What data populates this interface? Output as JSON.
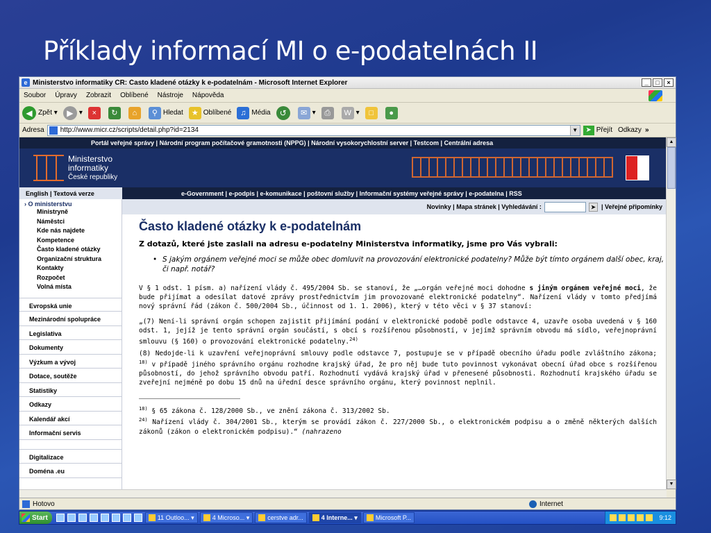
{
  "slide": {
    "title": "Příklady informací MI o e-podatelnách II"
  },
  "window": {
    "title": "Ministerstvo informatiky ČR: Často kladené otázky k e-podatelnám - Microsoft Internet Explorer"
  },
  "menu": [
    "Soubor",
    "Úpravy",
    "Zobrazit",
    "Oblíbené",
    "Nástroje",
    "Nápověda"
  ],
  "toolbar": {
    "back": "Zpět",
    "search": "Hledat",
    "favorites": "Oblíbené",
    "media": "Média"
  },
  "address": {
    "label": "Adresa",
    "url": "http://www.micr.cz/scripts/detail.php?id=2134",
    "go": "Přejít",
    "links": "Odkazy"
  },
  "portal_links": "Portál veřejné správy | Národní program počítačové gramotnosti (NPPG) | Národní vysokorychlostní server | Testcom | Centrální adresa",
  "logo": {
    "line1": "Ministerstvo",
    "line2": "informatiky",
    "line3": "České republiky"
  },
  "lang": "English | Textová verze",
  "nav_links": "e-Government | e-podpis | e-komunikace | poštovní služby | Informační systémy veřejné správy | e-podatelna | RSS",
  "topbar": {
    "links": "Novinky | Mapa stránek | Vyhledávání :",
    "extra": "| Veřejné připomínky"
  },
  "sidebar": {
    "head": "O ministerstvu",
    "sub": [
      "Ministryně",
      "Náměstci",
      "Kde nás najdete",
      "Kompetence",
      "Často kladené otázky",
      "Organizační struktura",
      "Kontakty",
      "Rozpočet",
      "Volná místa"
    ],
    "items": [
      "Evropská unie",
      "Mezinárodní spolupráce",
      "Legislativa",
      "Dokumenty",
      "Výzkum a vývoj",
      "Dotace, soutěže",
      "Statistiky",
      "Odkazy",
      "Kalendář akcí",
      "Informační servis"
    ],
    "items2": [
      "Digitalizace",
      "Doména .eu"
    ]
  },
  "content": {
    "title": "Často kladené otázky k e-podatelnám",
    "intro": "Z dotazů, které jste zaslali na adresu e-podatelny Ministerstva informatiky, jsme pro Vás vybrali:",
    "question": "S jakým orgánem veřejné moci se může obec domluvit na provozování elektronické podatelny? Může být tímto orgánem další obec, kraj, či např. notář?",
    "p1a": "V § 1 odst. 1 písm. a) nařízení vlády č. 495/2004 Sb. se stanoví, že „…orgán veřejné moci dohodne ",
    "p1b": "s jiným orgánem veřejné moci",
    "p1c": ", že bude přijímat a odesílat datové zprávy prostřednictvím jim provozované elektronické podatelny“. Nařízení vlády v tomto předjímá nový správní řád (zákon č. 500/2004 Sb., účinnost od 1. 1. 2006), který v této věci v § 37 stanoví:",
    "p2": "„(7) Není-li správní orgán schopen zajistit přijímání podání v elektronické podobě podle odstavce 4, uzavře osoba uvedená v § 160 odst. 1, jejíž je tento správní orgán součástí, s obcí s rozšířenou působností, v jejímž správním obvodu má sídlo, veřejnoprávní smlouvu (§ 160) o provozování elektronické podatelny.",
    "p2sup": "24)",
    "p3a": "(8) Nedojde-li k uzavření veřejnoprávní smlouvy podle odstavce 7, postupuje se v případě obecního úřadu podle zvláštního zákona;",
    "p3sup": "18)",
    "p3b": " v případě jiného správního orgánu rozhodne krajský úřad, že pro něj bude tuto povinnost vykonávat obecní úřad obce s rozšířenou působností, do jehož správního obvodu patří. Rozhodnutí vydává krajský úřad v přenesené působnosti. Rozhodnutí krajského úřadu se zveřejní nejméně po dobu 15 dnů na úřední desce správního orgánu, který povinnost neplnil.",
    "fn1sup": "18)",
    "fn1": " § 65 zákona č. 128/2000 Sb., ve znění zákona č. 313/2002 Sb.",
    "fn2sup": "24)",
    "fn2": " Nařízení vlády č. 304/2001 Sb., kterým se provádí zákon č. 227/2000 Sb., o elektronickém podpisu a o změně některých dalších zákonů (zákon o elektronickém podpisu).“",
    "fn2i": " (nahrazeno"
  },
  "status": {
    "text": "Hotovo",
    "zone": "Internet"
  },
  "taskbar": {
    "start": "Start",
    "tasks": [
      "11 Outloo...",
      "4 Microso...",
      "cerstve adr...",
      "4 Interne...",
      "Microsoft P..."
    ],
    "clock": "9:12"
  }
}
